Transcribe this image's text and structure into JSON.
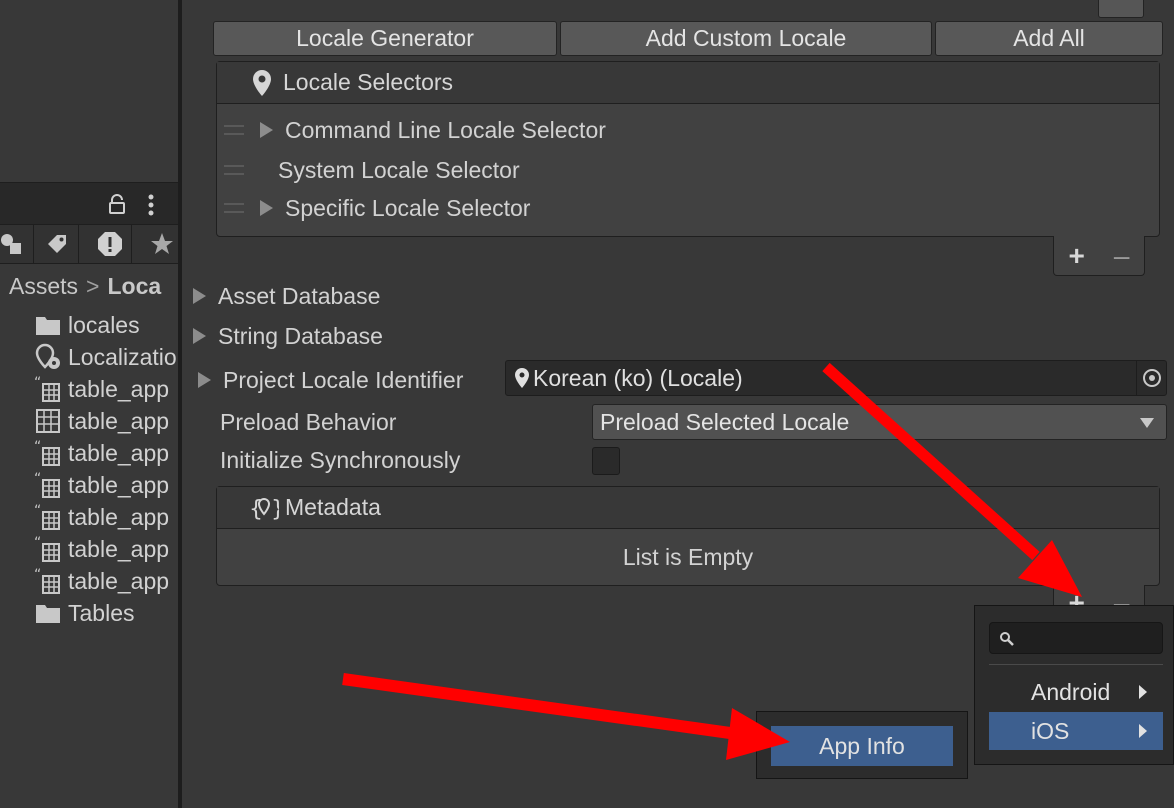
{
  "project_panel": {
    "breadcrumb": {
      "root": "Assets",
      "sep": ">",
      "current": "Loca"
    },
    "tab_icons": [
      "shapes-icon",
      "tag-icon",
      "warning-icon",
      "star-icon"
    ],
    "items": [
      {
        "label": "locales",
        "icon": "folder-icon"
      },
      {
        "label": "Localizatio",
        "icon": "localization-settings-icon"
      },
      {
        "label": "table_app",
        "icon": "string-table-icon"
      },
      {
        "label": "table_app",
        "icon": "table-icon"
      },
      {
        "label": "table_app",
        "icon": "string-table-icon"
      },
      {
        "label": "table_app",
        "icon": "string-table-icon"
      },
      {
        "label": "table_app",
        "icon": "string-table-icon"
      },
      {
        "label": "table_app",
        "icon": "string-table-icon"
      },
      {
        "label": "table_app",
        "icon": "string-table-icon"
      },
      {
        "label": "Tables",
        "icon": "folder-icon"
      }
    ]
  },
  "toolbar": {
    "locale_generator": "Locale Generator",
    "add_custom_locale": "Add Custom Locale",
    "add_all": "Add All"
  },
  "locale_selectors": {
    "title": "Locale Selectors",
    "items": [
      {
        "label": "Command Line Locale Selector",
        "expandable": true
      },
      {
        "label": "System Locale Selector",
        "expandable": false
      },
      {
        "label": "Specific Locale Selector",
        "expandable": true
      }
    ],
    "add": "+",
    "remove": "–"
  },
  "foldouts": {
    "asset_database": "Asset Database",
    "string_database": "String Database"
  },
  "project_locale": {
    "label": "Project Locale Identifier",
    "value": "Korean (ko) (Locale)"
  },
  "preload": {
    "label": "Preload Behavior",
    "value": "Preload Selected Locale"
  },
  "init_sync": {
    "label": "Initialize Synchronously",
    "checked": false
  },
  "metadata": {
    "title": "Metadata",
    "empty_text": "List is Empty",
    "add": "+",
    "remove": "–"
  },
  "platform_menu": {
    "search_placeholder": "",
    "items": [
      {
        "label": "Android",
        "selected": false
      },
      {
        "label": "iOS",
        "selected": true
      }
    ]
  },
  "submenu": {
    "items": [
      {
        "label": "App Info",
        "selected": true
      }
    ]
  },
  "colors": {
    "background": "#383838",
    "selection": "#3d5f8f",
    "annotation_arrow": "#ff0000"
  }
}
